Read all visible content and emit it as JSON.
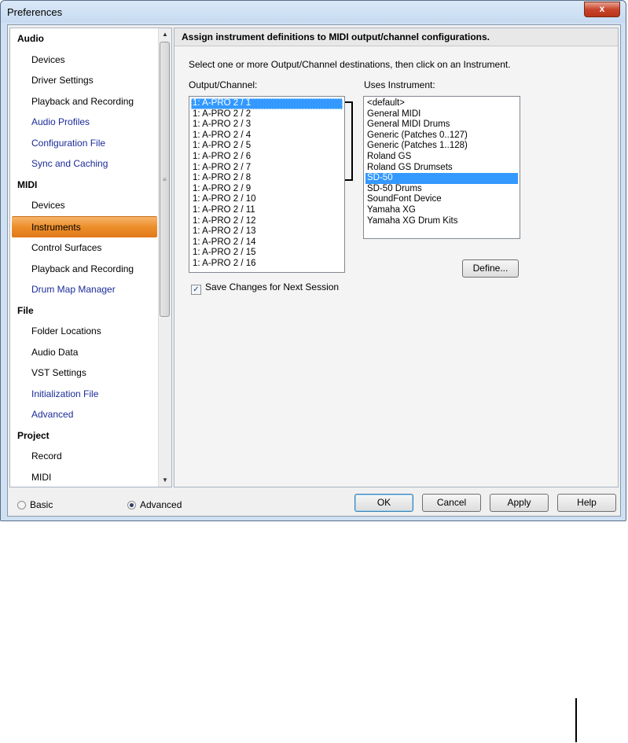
{
  "window": {
    "title": "Preferences",
    "close_glyph": "x"
  },
  "sidebar": {
    "categories": [
      {
        "label": "Audio",
        "items": [
          {
            "label": "Devices",
            "style": "normal"
          },
          {
            "label": "Driver Settings",
            "style": "normal"
          },
          {
            "label": "Playback and Recording",
            "style": "normal"
          },
          {
            "label": "Audio Profiles",
            "style": "blue"
          },
          {
            "label": "Configuration File",
            "style": "blue"
          },
          {
            "label": "Sync and Caching",
            "style": "blue"
          }
        ]
      },
      {
        "label": "MIDI",
        "items": [
          {
            "label": "Devices",
            "style": "normal"
          },
          {
            "label": "Instruments",
            "style": "selected"
          },
          {
            "label": "Control Surfaces",
            "style": "normal"
          },
          {
            "label": "Playback and Recording",
            "style": "normal"
          },
          {
            "label": "Drum Map Manager",
            "style": "blue"
          }
        ]
      },
      {
        "label": "File",
        "items": [
          {
            "label": "Folder Locations",
            "style": "normal"
          },
          {
            "label": "Audio Data",
            "style": "normal"
          },
          {
            "label": "VST Settings",
            "style": "normal"
          },
          {
            "label": "Initialization File",
            "style": "blue"
          },
          {
            "label": "Advanced",
            "style": "blue"
          }
        ]
      },
      {
        "label": "Project",
        "items": [
          {
            "label": "Record",
            "style": "normal"
          },
          {
            "label": "MIDI",
            "style": "normal"
          }
        ]
      }
    ],
    "scroll_up": "▲",
    "scroll_down": "▼",
    "grip": "≡"
  },
  "main": {
    "header": "Assign instrument definitions to MIDI output/channel configurations.",
    "instructions": "Select one or more Output/Channel destinations, then click on an Instrument.",
    "output_label": "Output/Channel:",
    "instrument_label": "Uses Instrument:",
    "outputs": [
      "1: A-PRO 2 / 1",
      "1: A-PRO 2 / 2",
      "1: A-PRO 2 / 3",
      "1: A-PRO 2 / 4",
      "1: A-PRO 2 / 5",
      "1: A-PRO 2 / 6",
      "1: A-PRO 2 / 7",
      "1: A-PRO 2 / 8",
      "1: A-PRO 2 / 9",
      "1: A-PRO 2 / 10",
      "1: A-PRO 2 / 11",
      "1: A-PRO 2 / 12",
      "1: A-PRO 2 / 13",
      "1: A-PRO 2 / 14",
      "1: A-PRO 2 / 15",
      "1: A-PRO 2 / 16"
    ],
    "selected_output": "1: A-PRO 2 / 1",
    "instruments": [
      "<default>",
      "General MIDI",
      "General MIDI Drums",
      "Generic (Patches 0..127)",
      "Generic (Patches 1..128)",
      "Roland GS",
      "Roland GS Drumsets",
      "SD-50",
      "SD-50 Drums",
      "SoundFont Device",
      "Yamaha XG",
      "Yamaha XG Drum Kits"
    ],
    "selected_instrument": "SD-50",
    "define_button": "Define...",
    "save_checkbox": {
      "label": "Save Changes for Next Session",
      "checked": true,
      "glyph": "✓"
    }
  },
  "footer": {
    "radio_basic": "Basic",
    "radio_advanced": "Advanced",
    "selected_mode": "Advanced",
    "ok": "OK",
    "cancel": "Cancel",
    "apply": "Apply",
    "help": "Help"
  }
}
